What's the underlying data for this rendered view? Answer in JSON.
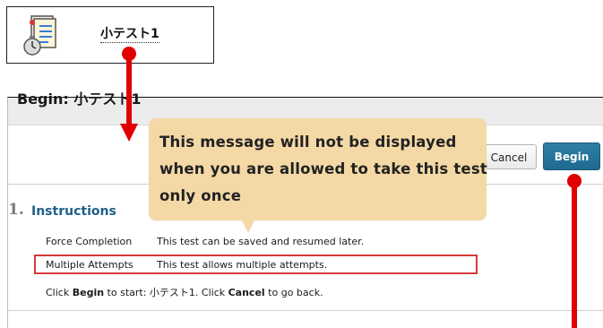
{
  "test_link": {
    "title": "小テスト1",
    "icon": "test-document-icon"
  },
  "page": {
    "title": "Begin: 小テスト1",
    "cancel_label": "Cancel",
    "begin_label": "Begin"
  },
  "instructions": {
    "number": "1.",
    "heading": "Instructions",
    "rows": [
      {
        "label": "Force Completion",
        "value": "This test can be saved and resumed later."
      },
      {
        "label": "Multiple Attempts",
        "value": "This test allows multiple attempts."
      }
    ],
    "start_prefix": "Click ",
    "start_begin": "Begin",
    "start_middle": " to start: 小テスト1. Click ",
    "start_cancel": "Cancel",
    "start_suffix": " to go back."
  },
  "callout": {
    "lines": [
      "This message will not be displayed",
      "when you are allowed to take this test",
      "only once"
    ]
  },
  "colors": {
    "marker_red": "#e00000",
    "callout_bg": "#f4d9a6",
    "begin_button": "#2577a0",
    "section_title": "#1f5f86",
    "highlight_border": "#d63b3b"
  }
}
